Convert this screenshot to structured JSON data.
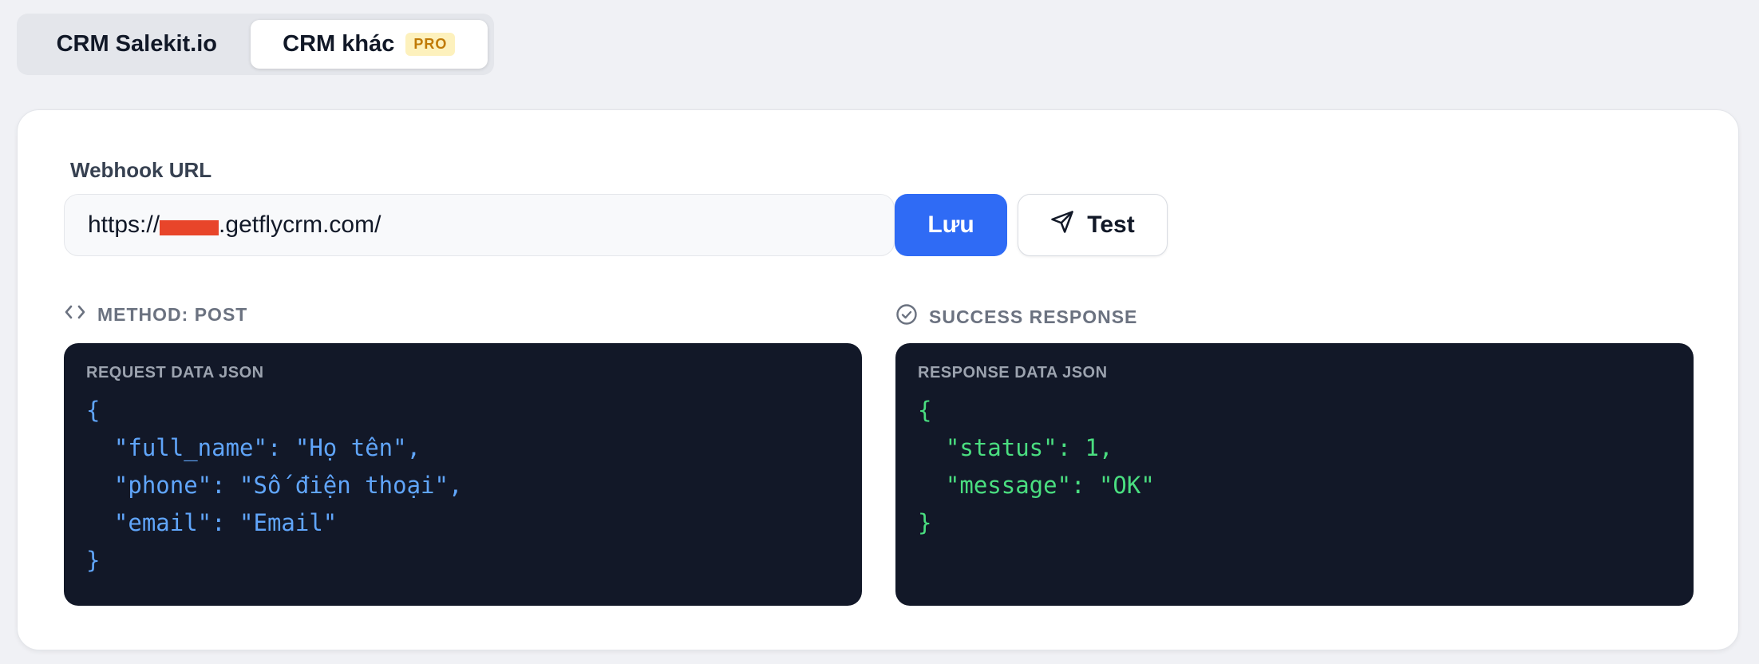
{
  "tabs": [
    {
      "label": "CRM Salekit.io",
      "active": false
    },
    {
      "label": "CRM khác",
      "active": true,
      "badge": "PRO"
    }
  ],
  "webhook": {
    "label": "Webhook URL",
    "value_prefix": "https://",
    "value_suffix": ".getflycrm.com/"
  },
  "buttons": {
    "save_label": "Lưu",
    "test_label": "Test"
  },
  "request": {
    "heading": "METHOD: POST",
    "title": "REQUEST DATA JSON",
    "lines": [
      "{",
      "  \"full_name\": \"Họ tên\",",
      "  \"phone\": \"Số điện thoại\",",
      "  \"email\": \"Email\"",
      "}"
    ]
  },
  "response": {
    "heading": "SUCCESS RESPONSE",
    "title": "RESPONSE DATA JSON",
    "lines": [
      "{",
      "  \"status\": 1,",
      "  \"message\": \"OK\"",
      "}"
    ]
  },
  "colors": {
    "accent": "#2f6bf5",
    "request_code": "#60a5fa",
    "response_code": "#4ade80",
    "redaction": "#e8452a"
  },
  "icons": {
    "method": "code-brackets-icon",
    "success": "check-circle-icon",
    "test": "send-icon"
  }
}
